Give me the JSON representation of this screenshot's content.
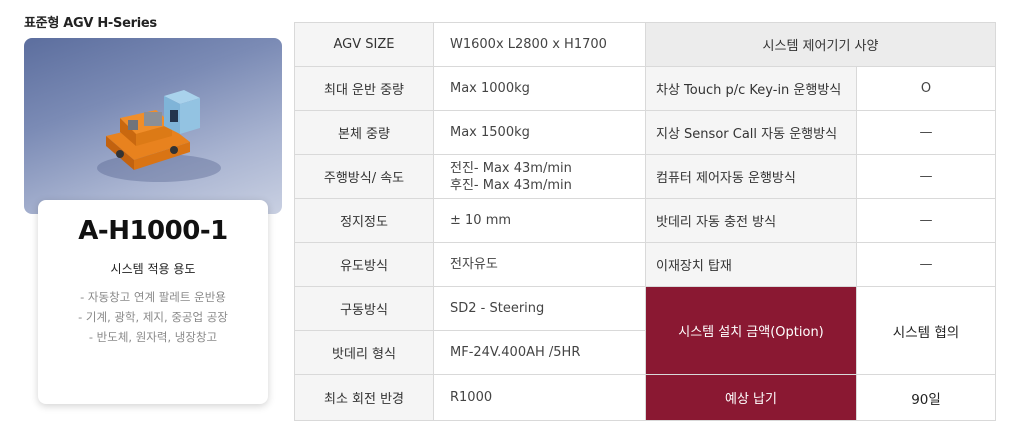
{
  "series_title": "표준형 AGV H-Series",
  "accent_color": "#8a1832",
  "model": {
    "name": "A-H1000-1",
    "usage_title": "시스템 적용 용도",
    "usage_items": [
      "- 자동창고 연계 팔레트 운반용",
      "- 기계, 광학, 제지, 중공업 공장",
      "- 반도체, 원자력, 냉장창고"
    ]
  },
  "specs": [
    {
      "label": "AGV SIZE",
      "value": "W1600x L2800 x H1700"
    },
    {
      "label": "최대 운반 중량",
      "value": "Max 1000kg"
    },
    {
      "label": "본체 중량",
      "value": "Max 1500kg"
    },
    {
      "label": "주행방식/ 속도",
      "value_line1": "전진- Max 43m/min",
      "value_line2": "후진- Max 43m/min"
    },
    {
      "label": "정지정도",
      "value": "± 10 mm"
    },
    {
      "label": "유도방식",
      "value": "전자유도"
    },
    {
      "label": "구동방식",
      "value": "SD2 - Steering"
    },
    {
      "label": "밧데리 형식",
      "value": "MF-24V.400AH /5HR"
    },
    {
      "label": "최소 회전 반경",
      "value": "R1000"
    }
  ],
  "control": {
    "header": "시스템 제어기기 사양",
    "rows": [
      {
        "label": "차상 Touch p/c Key-in 운행방식",
        "value": "O"
      },
      {
        "label": "지상 Sensor Call 자동 운행방식",
        "value": "—"
      },
      {
        "label": "컴퓨터 제어자동 운행방식",
        "value": "—"
      },
      {
        "label": "밧데리 자동 충전 방식",
        "value": "—"
      },
      {
        "label": "이재장치 탑재",
        "value": "—"
      }
    ]
  },
  "pricing": [
    {
      "label": "시스템 설치 금액(Option)",
      "value": "시스템 협의"
    },
    {
      "label": "예상 납기",
      "value": "90일"
    }
  ]
}
